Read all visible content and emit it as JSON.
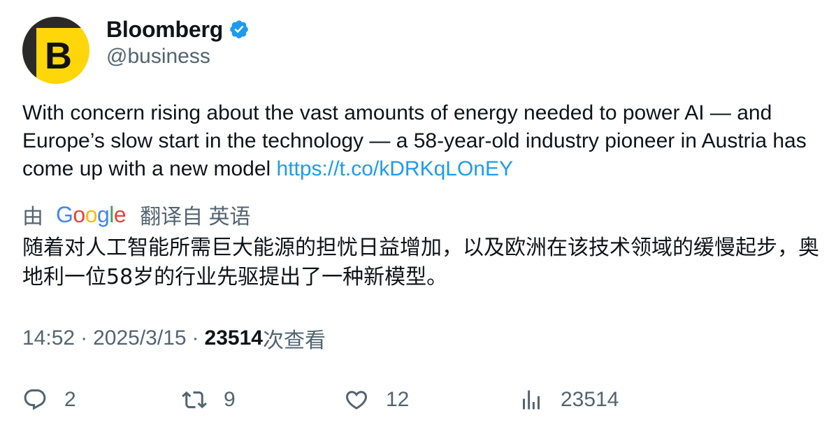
{
  "author": {
    "display_name": "Bloomberg",
    "handle": "@business",
    "avatar_letter": "B",
    "avatar_color": "#ffd60a",
    "verified_color": "#1d9bf0"
  },
  "tweet": {
    "text": "With concern rising about the vast amounts of energy needed to power AI — and Europe’s slow start in the technology — a 58-year-old industry pioneer in Austria has come up with a new model ",
    "link": "https://t.co/kDRKqLOnEY",
    "link_color": "#1d9bf0"
  },
  "translation": {
    "prefix": "由",
    "logo_letters": [
      "G",
      "o",
      "o",
      "g",
      "l",
      "e"
    ],
    "suffix": "翻译自 英语",
    "text": "随着对人工智能所需巨大能源的担忧日益增加，以及欧洲在该技术领域的缓慢起步，奥地利一位58岁的行业先驱提出了一种新模型。"
  },
  "meta": {
    "time": "14:52",
    "separator": "·",
    "date": "2025/3/15",
    "views_count": "23514",
    "views_label": "次查看"
  },
  "actions": {
    "reply_count": "2",
    "retweet_count": "9",
    "like_count": "12",
    "views_count": "23514",
    "icon_color": "#536471"
  }
}
